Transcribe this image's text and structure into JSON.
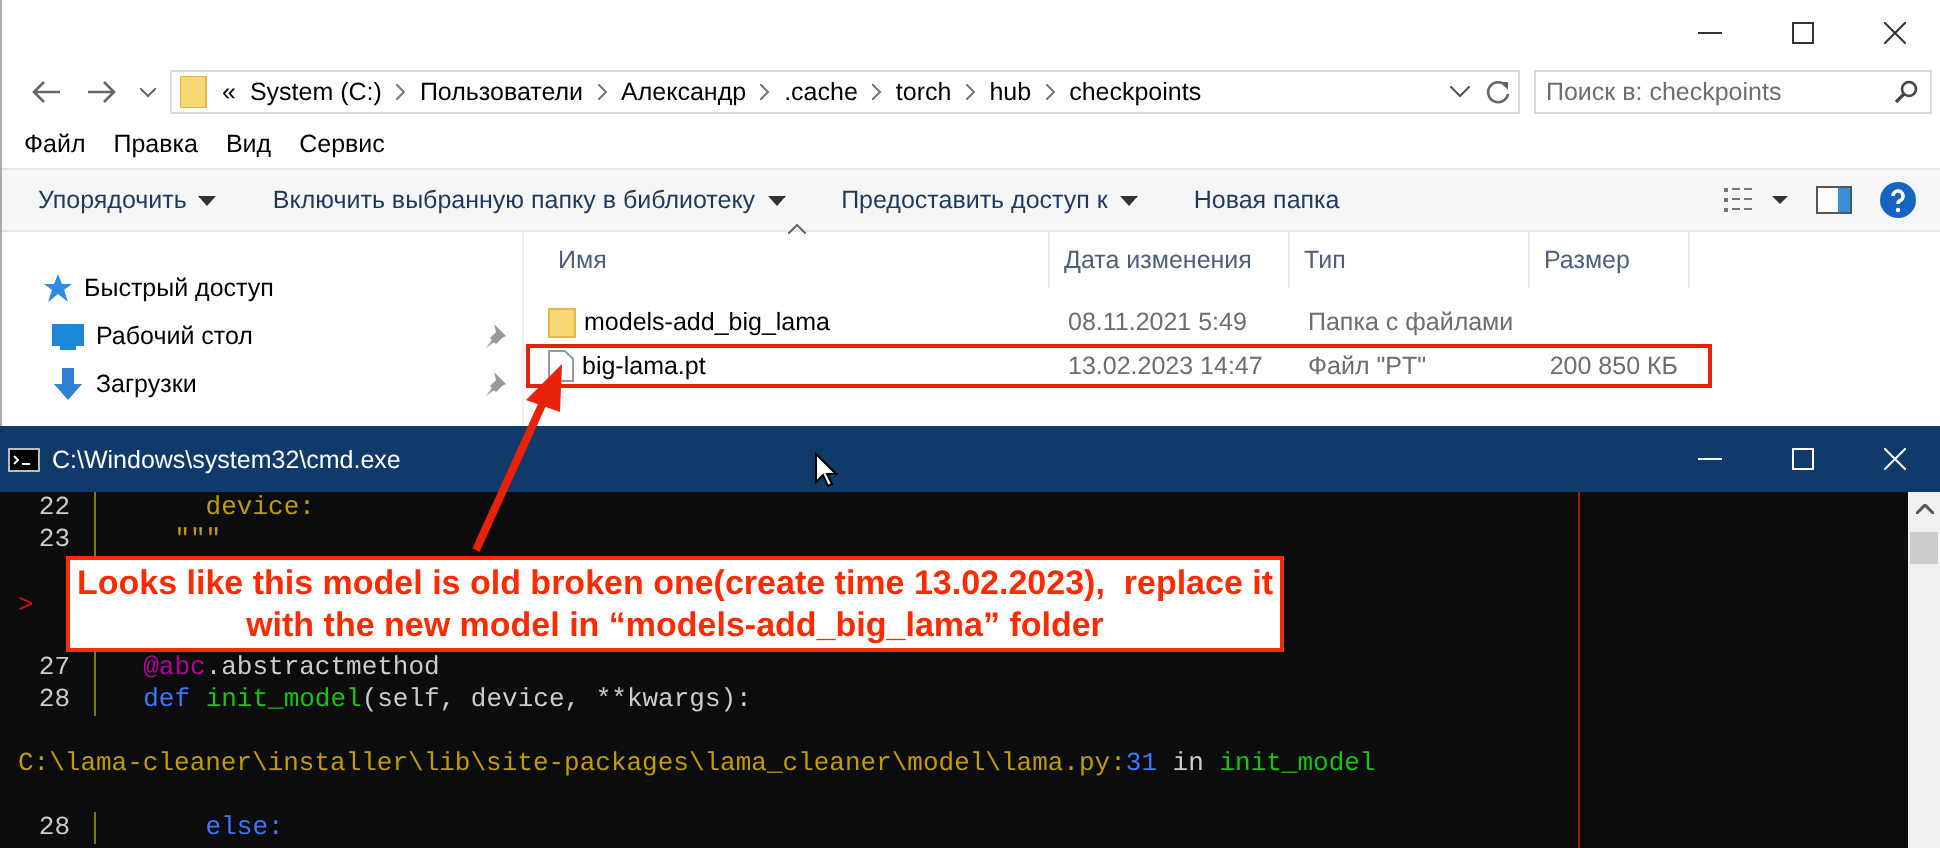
{
  "explorer": {
    "address": {
      "prefix": "«",
      "crumbs": [
        "System (C:)",
        "Пользователи",
        "Александр",
        ".cache",
        "torch",
        "hub",
        "checkpoints"
      ]
    },
    "search": {
      "placeholder": "Поиск в: checkpoints"
    },
    "menu": [
      "Файл",
      "Правка",
      "Вид",
      "Сервис"
    ],
    "toolbar": [
      {
        "label": "Упорядочить",
        "dropdown": true
      },
      {
        "label": "Включить выбранную папку в библиотеку",
        "dropdown": true
      },
      {
        "label": "Предоставить доступ к",
        "dropdown": true
      },
      {
        "label": "Новая папка",
        "dropdown": false
      }
    ],
    "sidebar": [
      {
        "label": "Быстрый доступ",
        "kind": "star",
        "pinned": false
      },
      {
        "label": "Рабочий стол",
        "kind": "desktop",
        "pinned": true
      },
      {
        "label": "Загрузки",
        "kind": "downloads",
        "pinned": true
      }
    ],
    "columns": [
      {
        "label": "Имя",
        "sorted": true
      },
      {
        "label": "Дата изменения",
        "sorted": false
      },
      {
        "label": "Тип",
        "sorted": false
      },
      {
        "label": "Размер",
        "sorted": false
      }
    ],
    "rows": [
      {
        "kind": "folder",
        "name": "models-add_big_lama",
        "date": "08.11.2021 5:49",
        "type": "Папка с файлами",
        "highlighted": false
      },
      {
        "kind": "file",
        "name": "big-lama.pt",
        "date": "13.02.2023 14:47",
        "type": "Файл \"PT\"",
        "size": "200 850 КБ",
        "highlighted": true
      }
    ]
  },
  "console": {
    "title": "C:\\Windows\\system32\\cmd.exe",
    "lines": [
      {
        "kind": "code",
        "number": "22",
        "tokens": [
          {
            "text": "      device:",
            "kind": "string"
          }
        ]
      },
      {
        "kind": "code",
        "number": "23",
        "tokens": [
          {
            "text": "    \"\"\"",
            "kind": "string"
          }
        ]
      },
      {
        "kind": "blank"
      },
      {
        "kind": "marker",
        "marker": ">"
      },
      {
        "kind": "blank"
      },
      {
        "kind": "code",
        "number": "27",
        "tokens": [
          {
            "text": "  @abc",
            "kind": "decorator"
          },
          {
            "text": ".abstractmethod",
            "kind": "plain"
          }
        ]
      },
      {
        "kind": "code",
        "number": "28",
        "tokens": [
          {
            "text": "  def ",
            "kind": "keyword"
          },
          {
            "text": "init_model",
            "kind": "func"
          },
          {
            "text": "(self, device, **kwargs):",
            "kind": "plain"
          }
        ]
      },
      {
        "kind": "blank"
      },
      {
        "kind": "text",
        "tokens": [
          {
            "text": "C:\\lama-cleaner\\installer\\lib\\site-packages\\lama_cleaner\\model\\lama.py:",
            "kind": "string"
          },
          {
            "text": "31",
            "kind": "keyword"
          },
          {
            "text": " in ",
            "kind": "plain"
          },
          {
            "text": "init_model",
            "kind": "func"
          }
        ]
      },
      {
        "kind": "blank"
      },
      {
        "kind": "code",
        "number": "28",
        "tokens": [
          {
            "text": "      else:",
            "kind": "keyword"
          }
        ]
      }
    ]
  },
  "annotation": {
    "text": "Looks like this model is old broken one(create time 13.02.2023),  replace it\nwith the new model in “models-add_big_lama” folder"
  }
}
